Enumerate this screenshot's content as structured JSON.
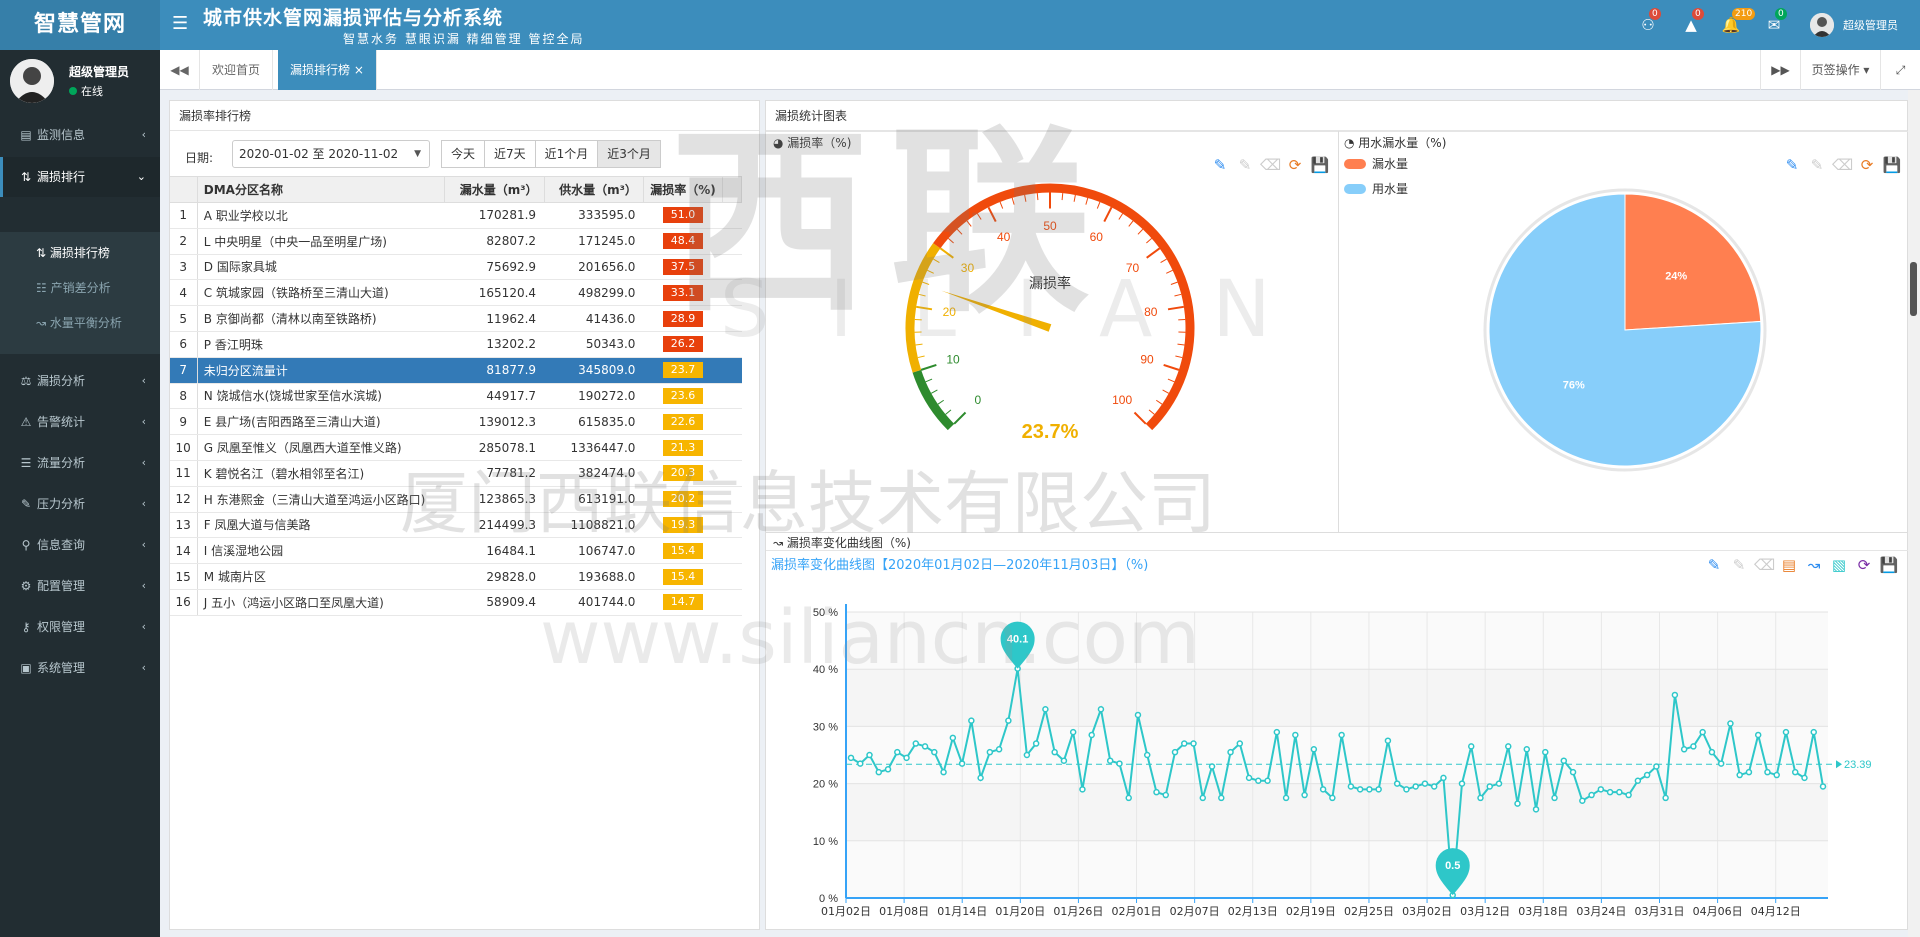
{
  "app": {
    "logo": "智慧管网",
    "title": "城市供水管网漏损评估与分析系统",
    "slogan": "智慧水务 慧眼识漏 精细管理 管控全局"
  },
  "header": {
    "badges": [
      "0",
      "0",
      "210",
      "0"
    ],
    "user": "超级管理员"
  },
  "sidebar": {
    "user": "超级管理员",
    "status": "在线",
    "items": [
      {
        "label": "监测信息"
      },
      {
        "label": "漏损排行"
      },
      {
        "label": "漏损分析"
      },
      {
        "label": "告警统计"
      },
      {
        "label": "流量分析"
      },
      {
        "label": "压力分析"
      },
      {
        "label": "信息查询"
      },
      {
        "label": "配置管理"
      },
      {
        "label": "权限管理"
      },
      {
        "label": "系统管理"
      }
    ],
    "subitems": [
      {
        "label": "漏损排行榜"
      },
      {
        "label": "产销差分析"
      },
      {
        "label": "水量平衡分析"
      }
    ]
  },
  "tabs": {
    "home": "欢迎首页",
    "current": "漏损排行榜",
    "close": "×",
    "ops": "页签操作"
  },
  "rank": {
    "title": "漏损率排行榜",
    "date_label": "日期:",
    "date_value": "2020-01-02 至 2020-11-02",
    "ranges": [
      "今天",
      "近7天",
      "近1个月",
      "近3个月"
    ],
    "headers": [
      "DMA分区名称",
      "漏水量（m³）",
      "供水量（m³）",
      "漏损率（%)"
    ],
    "rows": [
      {
        "i": "1",
        "name": "A 职业学校以北",
        "leak": "170281.9",
        "supply": "333595.0",
        "rate": "51.0",
        "level": "red"
      },
      {
        "i": "2",
        "name": "L 中央明星（中央一品至明星广场)",
        "leak": "82807.2",
        "supply": "171245.0",
        "rate": "48.4",
        "level": "red"
      },
      {
        "i": "3",
        "name": "D 国际家具城",
        "leak": "75692.9",
        "supply": "201656.0",
        "rate": "37.5",
        "level": "red"
      },
      {
        "i": "4",
        "name": "C 筑城家园（铁路桥至三清山大道)",
        "leak": "165120.4",
        "supply": "498299.0",
        "rate": "33.1",
        "level": "red"
      },
      {
        "i": "5",
        "name": "B 京御尚都（清林以南至铁路桥)",
        "leak": "11962.4",
        "supply": "41436.0",
        "rate": "28.9",
        "level": "red"
      },
      {
        "i": "6",
        "name": "P 香江明珠",
        "leak": "13202.2",
        "supply": "50343.0",
        "rate": "26.2",
        "level": "red"
      },
      {
        "i": "7",
        "name": "未归分区流量计",
        "leak": "81877.9",
        "supply": "345809.0",
        "rate": "23.7",
        "level": "orange"
      },
      {
        "i": "8",
        "name": "N 饶城信水(饶城世家至信水滨城)",
        "leak": "44917.7",
        "supply": "190272.0",
        "rate": "23.6",
        "level": "orange"
      },
      {
        "i": "9",
        "name": "E 县广场(吉阳西路至三清山大道)",
        "leak": "139012.3",
        "supply": "615835.0",
        "rate": "22.6",
        "level": "orange"
      },
      {
        "i": "10",
        "name": "G 凤凰至惟义（凤凰西大道至惟义路)",
        "leak": "285078.1",
        "supply": "1336447.0",
        "rate": "21.3",
        "level": "orange"
      },
      {
        "i": "11",
        "name": "K 碧悦名江（碧水相邻至名江)",
        "leak": "77781.2",
        "supply": "382474.0",
        "rate": "20.3",
        "level": "orange"
      },
      {
        "i": "12",
        "name": "H 东港熙金（三清山大道至鸿运小区路口)",
        "leak": "123865.3",
        "supply": "613191.0",
        "rate": "20.2",
        "level": "orange"
      },
      {
        "i": "13",
        "name": "F 凤凰大道与信美路",
        "leak": "214499.3",
        "supply": "1108821.0",
        "rate": "19.3",
        "level": "orange"
      },
      {
        "i": "14",
        "name": "I 信溪湿地公园",
        "leak": "16484.1",
        "supply": "106747.0",
        "rate": "15.4",
        "level": "orange"
      },
      {
        "i": "15",
        "name": "M 城南片区",
        "leak": "29828.0",
        "supply": "193688.0",
        "rate": "15.4",
        "level": "orange"
      },
      {
        "i": "16",
        "name": "J 五小（鸿运小区路口至凤凰大道)",
        "leak": "58909.4",
        "supply": "401744.0",
        "rate": "14.7",
        "level": "orange"
      }
    ]
  },
  "charts_panel": {
    "title": "漏损统计图表",
    "gauge_title": "漏损率（%)",
    "pie_title": "用水漏水量（%)",
    "line_section": "漏损率变化曲线图（%)"
  },
  "chart_data": [
    {
      "type": "gauge",
      "title": "漏损率",
      "value": 23.7,
      "value_label": "23.7%",
      "min": 0,
      "max": 100,
      "ticks": [
        "0",
        "10",
        "20",
        "30",
        "40",
        "50",
        "60",
        "70",
        "80",
        "90",
        "100"
      ],
      "bands": [
        {
          "to": 10,
          "color": "#2e8b2e"
        },
        {
          "to": 30,
          "color": "#f0b000"
        },
        {
          "to": 100,
          "color": "#f04a0c"
        }
      ]
    },
    {
      "type": "pie",
      "legend": [
        "漏水量",
        "用水量"
      ],
      "values": [
        24,
        76
      ],
      "labels": [
        "24%",
        "76%"
      ],
      "colors": [
        "#ff7f50",
        "#87cefa"
      ]
    },
    {
      "type": "line",
      "title": "漏损率变化曲线图【2020年01月02日—2020年11月03日】（%)",
      "y_ticks": [
        "0 %",
        "10 %",
        "20 %",
        "30 %",
        "40 %",
        "50 %"
      ],
      "ylim": [
        0,
        50
      ],
      "x_labels": [
        "01月02日",
        "01月08日",
        "01月14日",
        "01月20日",
        "01月26日",
        "02月01日",
        "02月07日",
        "02月13日",
        "02月19日",
        "02月25日",
        "03月02日",
        "03月12日",
        "03月18日",
        "03月24日",
        "03月31日",
        "04月06日",
        "04月12日"
      ],
      "mean": 23.39,
      "mean_label": "23.39",
      "max_label": "40.1",
      "min_label": "0.5",
      "max_index": 18,
      "min_index": 65,
      "color": "#2ec7c9",
      "values": [
        24.5,
        23.5,
        25,
        22,
        22.5,
        25.5,
        24.5,
        27,
        26.5,
        25.5,
        22,
        28,
        23.5,
        31,
        21,
        25.5,
        26,
        31,
        40.1,
        25,
        27,
        33,
        25.5,
        24,
        29,
        19,
        28.5,
        33,
        24,
        23.5,
        17.5,
        32,
        25,
        18.5,
        18,
        25.5,
        27,
        27,
        17.5,
        23,
        17.5,
        25.5,
        27,
        21,
        20.5,
        20.5,
        29,
        17.5,
        28.5,
        18,
        26,
        19,
        17.5,
        28.5,
        19.5,
        19,
        19,
        19,
        27.5,
        20,
        19,
        19.5,
        20,
        19.5,
        21,
        0.5,
        20,
        26.5,
        17.5,
        19.5,
        20,
        26.5,
        16.5,
        26,
        15.5,
        25.5,
        17.5,
        24,
        22,
        17,
        18,
        19,
        18.5,
        18.5,
        18,
        20.5,
        21.5,
        23,
        17.5,
        35.5,
        26,
        26.5,
        29,
        25.5,
        23.5,
        30.5,
        21.5,
        22,
        28.5,
        22,
        21.5,
        29,
        22,
        21,
        29,
        19.5
      ]
    }
  ],
  "watermark": {
    "brand": "西联",
    "brand_en": "SILIAN",
    "company": "厦门西联信息技术有限公司",
    "url": "www.siliancn.com"
  }
}
